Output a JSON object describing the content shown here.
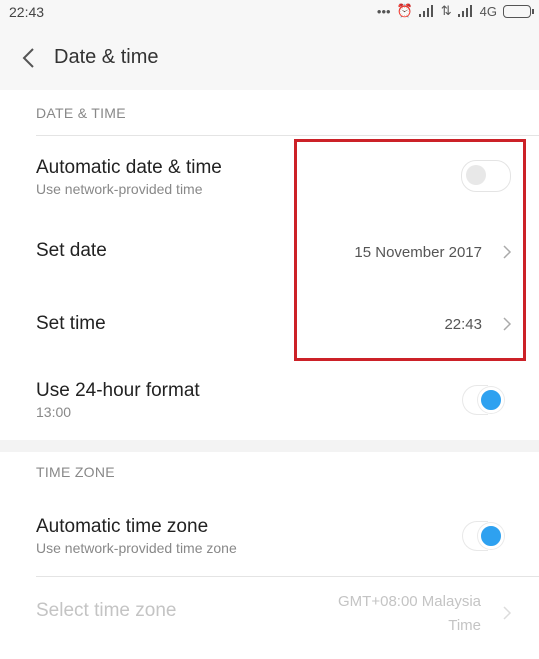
{
  "status_bar": {
    "time": "22:43",
    "network": "4G",
    "icons": [
      "more-dots-icon",
      "alarm-icon",
      "signal-icon",
      "data-arrows-icon",
      "signal-icon",
      "battery-icon"
    ]
  },
  "app_bar": {
    "title": "Date & time"
  },
  "date_time_section": {
    "label": "DATE & TIME",
    "automatic": {
      "title": "Automatic date & time",
      "subtitle": "Use network-provided time",
      "enabled": false
    },
    "set_date": {
      "title": "Set date",
      "value": "15 November 2017"
    },
    "set_time": {
      "title": "Set time",
      "value": "22:43"
    },
    "format_24h": {
      "title": "Use 24-hour format",
      "subtitle": "13:00",
      "enabled": true
    }
  },
  "time_zone_section": {
    "label": "TIME ZONE",
    "automatic_tz": {
      "title": "Automatic time zone",
      "subtitle": "Use network-provided time zone",
      "enabled": true
    },
    "select_tz": {
      "title": "Select time zone",
      "value_line1": "GMT+08:00 Malaysia",
      "value_line2": "Time"
    }
  },
  "colors": {
    "accent": "#2ea1f0",
    "highlight": "#cc2128"
  }
}
